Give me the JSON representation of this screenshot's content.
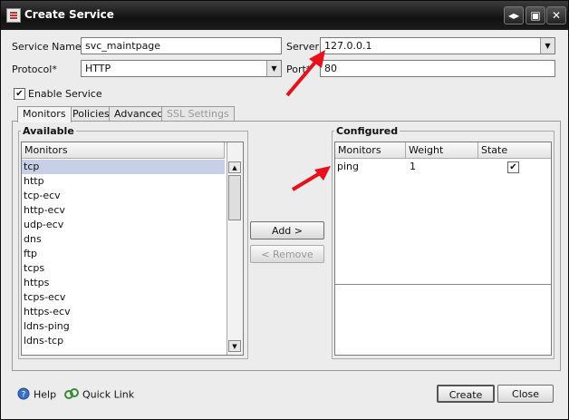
{
  "window": {
    "title": "Create Service"
  },
  "form": {
    "service_name_label": "Service Name*",
    "service_name_value": "svc_maintpage",
    "server_label": "Server",
    "server_value": "127.0.0.1",
    "protocol_label": "Protocol*",
    "protocol_value": "HTTP",
    "port_label": "Port*",
    "port_value": "80",
    "enable_service_label": "Enable Service",
    "enable_service_checked": true
  },
  "tabs": [
    {
      "label": "Monitors",
      "active": true
    },
    {
      "label": "Policies"
    },
    {
      "label": "Advanced"
    },
    {
      "label": "SSL Settings",
      "disabled": true
    }
  ],
  "available": {
    "title": "Available",
    "column": "Monitors",
    "items": [
      "tcp",
      "http",
      "tcp-ecv",
      "http-ecv",
      "udp-ecv",
      "dns",
      "ftp",
      "tcps",
      "https",
      "tcps-ecv",
      "https-ecv",
      "ldns-ping",
      "ldns-tcp"
    ],
    "selected": "tcp"
  },
  "configured": {
    "title": "Configured",
    "columns": [
      "Monitors",
      "Weight",
      "State"
    ],
    "rows": [
      {
        "monitor": "ping",
        "weight": "1",
        "state_checked": true
      }
    ]
  },
  "buttons": {
    "add": "Add >",
    "remove": "< Remove",
    "help": "Help",
    "quick_link": "Quick Link",
    "create": "Create",
    "close": "Close"
  },
  "colors": {
    "annotation_arrow": "#e8101a",
    "titlebar": "#1c1c1c",
    "selection": "#c8d0e8"
  }
}
